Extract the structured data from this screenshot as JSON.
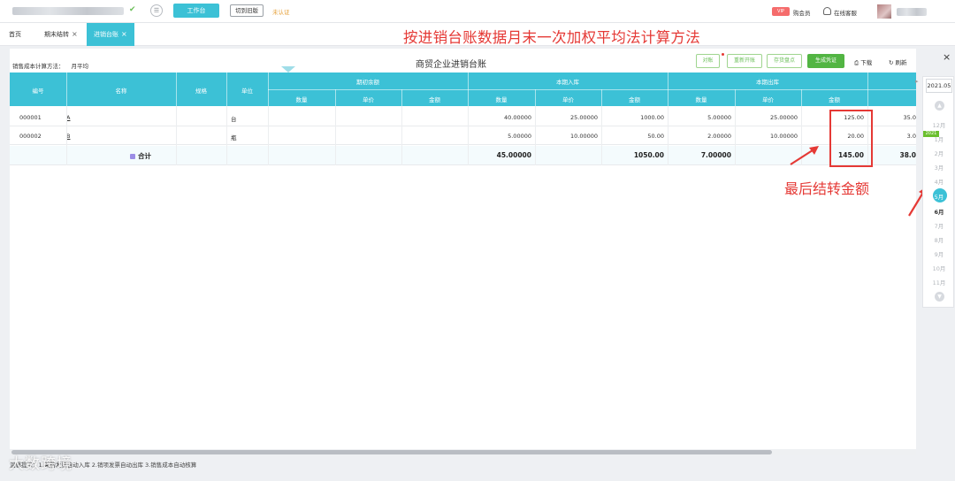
{
  "topbar": {
    "workbench_label": "工作台",
    "switch_label": "切到旧版",
    "unverified_label": "未认证",
    "vip_badge": "VIP",
    "vip_label": "购会员",
    "service_label": "在线客服"
  },
  "tabs": [
    {
      "label": "首页",
      "close": ""
    },
    {
      "label": "期末结转",
      "close": "×"
    },
    {
      "label": "进销台账",
      "close": "×"
    }
  ],
  "tab_close_all": "×",
  "caption": "按进销台账数据月末一次加权平均法计算方法",
  "panel": {
    "method_label": "销售成本计算方法：",
    "method_value": "月平均",
    "title": "商贸企业进销台账",
    "actions": {
      "check": "对账",
      "reopen": "重新开账",
      "inventory": "存货盘点",
      "generate": "生成凭证",
      "download": "下载",
      "refresh": "刷新"
    }
  },
  "table": {
    "headers": {
      "code": "编号",
      "name": "名称",
      "spec": "规格",
      "unit": "单位",
      "opening": "期初余额",
      "inbound": "本期入库",
      "outbound": "本期出库",
      "qty": "数量",
      "price": "单价",
      "amount": "金额"
    },
    "rows": [
      {
        "code": "000001",
        "name": "A",
        "spec": "",
        "unit": "台",
        "open_qty": "",
        "open_price": "",
        "open_amount": "",
        "in_qty": "40.00000",
        "in_price": "25.00000",
        "in_amount": "1000.00",
        "out_qty": "5.00000",
        "out_price": "25.00000",
        "out_amount": "125.00",
        "next": "35.0"
      },
      {
        "code": "000002",
        "name": "B",
        "spec": "",
        "unit": "瓶",
        "open_qty": "",
        "open_price": "",
        "open_amount": "",
        "in_qty": "5.00000",
        "in_price": "10.00000",
        "in_amount": "50.00",
        "out_qty": "2.00000",
        "out_price": "10.00000",
        "out_amount": "20.00",
        "next": "3.0"
      }
    ],
    "total": {
      "label": "合计",
      "in_qty": "45.00000",
      "in_amount": "1050.00",
      "out_qty": "7.00000",
      "out_amount": "145.00",
      "next": "38.0"
    }
  },
  "annotation": "最后结转金额",
  "footer": "温馨提示：1.采购发票自动入库 2.销项发票自动出库 3.销售成本自动核算",
  "watermark": "大数跨境",
  "periods": {
    "selected": "2021.05",
    "year_tag": "2021",
    "months": [
      "12月",
      "1月",
      "2月",
      "3月",
      "4月",
      "5月",
      "6月",
      "7月",
      "8月",
      "9月",
      "10月",
      "11月"
    ],
    "current_month": "5月"
  },
  "colors": {
    "accent": "#3cc1d6",
    "green": "#52b543",
    "annotation_red": "#e53935"
  }
}
